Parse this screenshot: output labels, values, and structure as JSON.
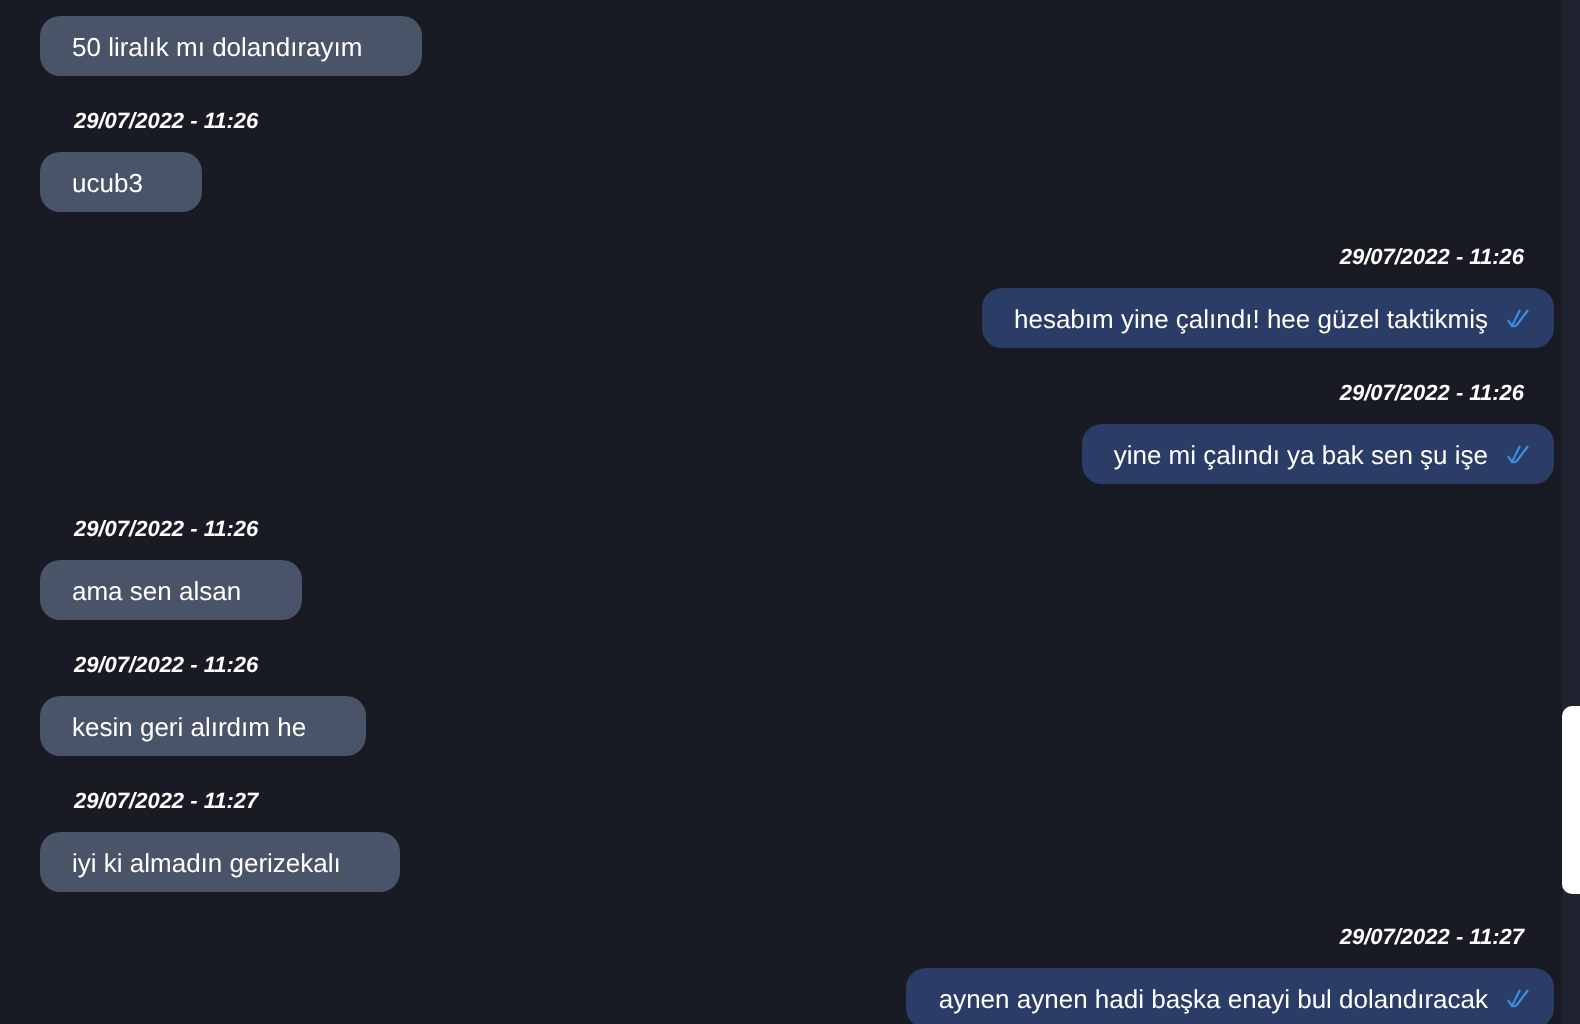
{
  "messages": [
    {
      "kind": "incoming",
      "text": "50 liralık mı dolandırayım"
    },
    {
      "kind": "incoming",
      "timestamp": "29/07/2022 - 11:26",
      "text": "ucub3"
    },
    {
      "kind": "outgoing",
      "timestamp": "29/07/2022 - 11:26",
      "text": "hesabım yine çalındı! hee güzel taktikmiş",
      "read": true
    },
    {
      "kind": "outgoing",
      "timestamp": "29/07/2022 - 11:26",
      "text": "yine mi çalındı ya bak sen şu işe",
      "read": true
    },
    {
      "kind": "incoming",
      "timestamp": "29/07/2022 - 11:26",
      "text": "ama sen alsan"
    },
    {
      "kind": "incoming",
      "timestamp": "29/07/2022 - 11:26",
      "text": "kesin geri alırdım he"
    },
    {
      "kind": "incoming",
      "timestamp": "29/07/2022 - 11:27",
      "text": "iyi ki almadın gerizekalı"
    },
    {
      "kind": "outgoing",
      "timestamp": "29/07/2022 - 11:27",
      "text": "aynen aynen hadi başka enayi bul dolandıracak",
      "read": true
    }
  ]
}
